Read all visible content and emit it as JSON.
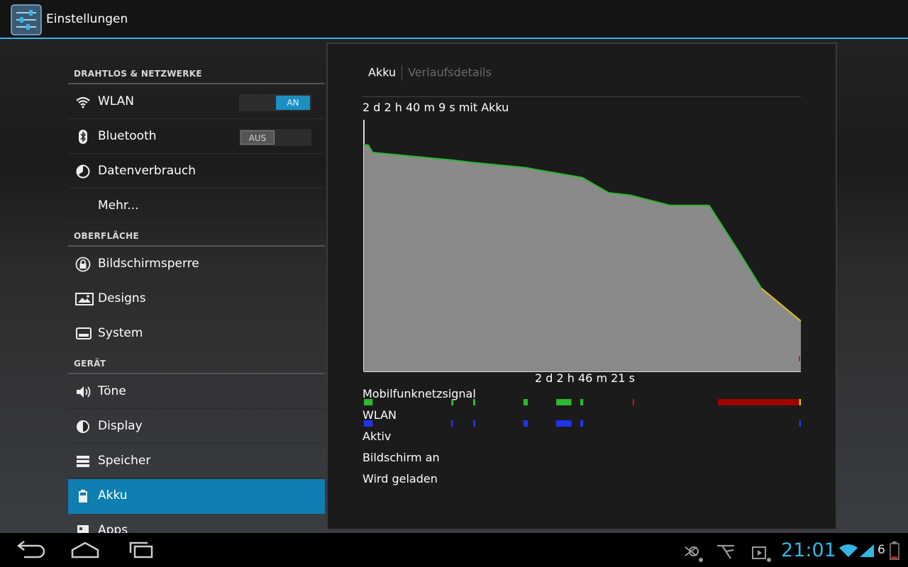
{
  "app": {
    "title": "Einstellungen"
  },
  "sections": [
    {
      "header": "DRAHTLOS & NETZWERKE"
    },
    {
      "header": "OBERFLÄCHE"
    },
    {
      "header": "GERÄT"
    }
  ],
  "items": {
    "wlan": {
      "label": "WLAN",
      "toggle": "AN"
    },
    "bluetooth": {
      "label": "Bluetooth",
      "toggle": "AUS"
    },
    "data": {
      "label": "Datenverbrauch"
    },
    "more": {
      "label": "Mehr..."
    },
    "lock": {
      "label": "Bildschirmsperre"
    },
    "designs": {
      "label": "Designs"
    },
    "system": {
      "label": "System"
    },
    "sound": {
      "label": "Töne"
    },
    "display": {
      "label": "Display"
    },
    "storage": {
      "label": "Speicher"
    },
    "battery": {
      "label": "Akku"
    },
    "apps": {
      "label": "Apps"
    }
  },
  "panel": {
    "tab_active": "Akku",
    "tab_inactive": "Verlaufsdetails",
    "duration": "2 d 2 h 40 m 9 s mit Akku",
    "elapsed": "2 d 2 h 46 m 21 s",
    "tracks": [
      "Mobilfunknetzsignal",
      "WLAN",
      "Aktiv",
      "Bildschirm an",
      "Wird geladen"
    ]
  },
  "chart_data": {
    "type": "area",
    "ylim": [
      0,
      100
    ],
    "xlim": [
      0,
      100
    ],
    "x": [
      0,
      1,
      2,
      20,
      20,
      25,
      25,
      37,
      37,
      40,
      40,
      50,
      50,
      56,
      56,
      61,
      61,
      70,
      79,
      86,
      91,
      100
    ],
    "values": [
      90,
      90,
      87,
      84,
      84,
      83,
      83,
      81,
      81,
      80,
      80,
      77,
      77,
      71,
      71,
      70,
      70,
      66,
      66,
      47,
      33,
      20
    ],
    "line_colors": {
      "normal": "#2db82d",
      "low": "#d9c41a",
      "critical": "#c41a1a"
    },
    "fill": "#8a8a8a"
  },
  "nav": {
    "clock": "21:01",
    "battery_number": "6"
  },
  "colors": {
    "accent": "#33b5e5",
    "selected": "#0e7fb0",
    "signal_green": "#2db82d",
    "signal_red": "#a00000",
    "blue": "#2233ee"
  }
}
